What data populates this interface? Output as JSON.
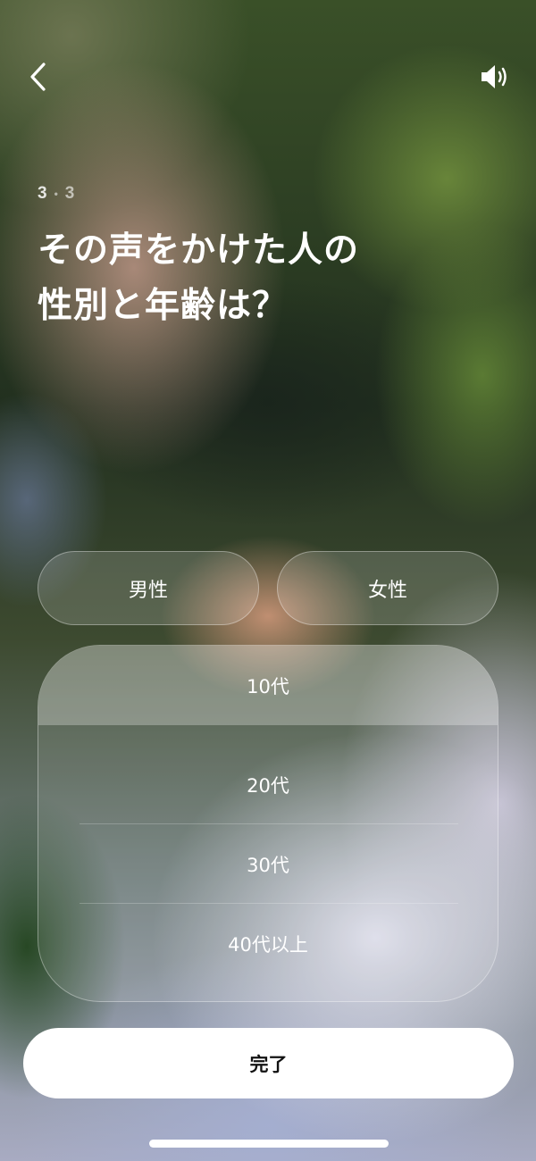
{
  "header": {
    "back_icon": "chevron-left-icon",
    "sound_icon": "speaker-icon"
  },
  "step": {
    "current": "3",
    "separator": "•",
    "total": "3"
  },
  "question": {
    "line1": "その声をかけた人の",
    "line2": "性別と年齢は？"
  },
  "gender": {
    "male_label": "男性",
    "female_label": "女性"
  },
  "age": {
    "options": [
      "10代",
      "20代",
      "30代",
      "40代以上"
    ],
    "selected": "10代"
  },
  "footer": {
    "done_label": "完了"
  },
  "colors": {
    "text": "#FFFFFF",
    "done_button_bg": "#FFFFFF",
    "done_button_text": "#111111"
  }
}
